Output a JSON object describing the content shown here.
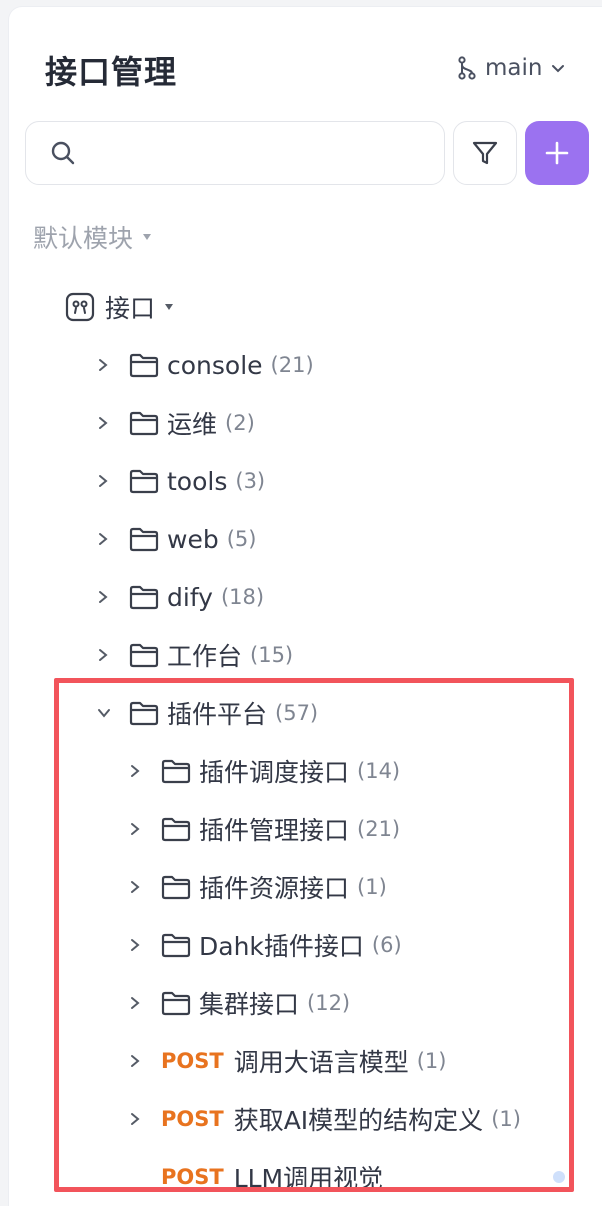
{
  "header": {
    "title": "接口管理",
    "branch": "main"
  },
  "search": {
    "placeholder": ""
  },
  "module": {
    "label": "默认模块"
  },
  "api_root": {
    "label": "接口"
  },
  "folders": [
    {
      "label": "console",
      "count": "(21)"
    },
    {
      "label": "运维",
      "count": "(2)"
    },
    {
      "label": "tools",
      "count": "(3)"
    },
    {
      "label": "web",
      "count": "(5)"
    },
    {
      "label": "dify",
      "count": "(18)"
    },
    {
      "label": "工作台",
      "count": "(15)"
    },
    {
      "label": "插件平台",
      "count": "(57)"
    }
  ],
  "plugin_children": [
    {
      "label": "插件调度接口",
      "count": "(14)"
    },
    {
      "label": "插件管理接口",
      "count": "(21)"
    },
    {
      "label": "插件资源接口",
      "count": "(1)"
    },
    {
      "label": "Dahk插件接口",
      "count": "(6)"
    },
    {
      "label": "集群接口",
      "count": "(12)"
    }
  ],
  "plugin_apis": [
    {
      "method": "POST",
      "label": "调用大语言模型",
      "count": "(1)"
    },
    {
      "method": "POST",
      "label": "获取AI模型的结构定义",
      "count": "(1)"
    },
    {
      "method": "POST",
      "label": "LLM调用视觉",
      "count": ""
    }
  ],
  "colors": {
    "accent": "#9b72f0",
    "method_post": "#e8731f",
    "highlight": "#f2545b"
  }
}
